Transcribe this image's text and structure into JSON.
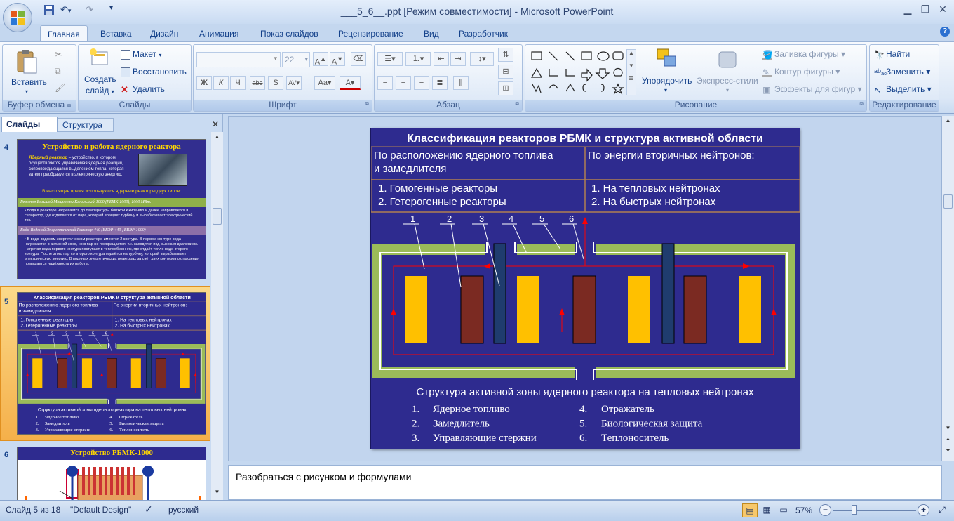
{
  "window": {
    "title": "___5_6__.ppt [Режим совместимости] - Microsoft PowerPoint"
  },
  "tabs": [
    {
      "label": "Главная",
      "active": true
    },
    {
      "label": "Вставка"
    },
    {
      "label": "Дизайн"
    },
    {
      "label": "Анимация"
    },
    {
      "label": "Показ слайдов"
    },
    {
      "label": "Рецензирование"
    },
    {
      "label": "Вид"
    },
    {
      "label": "Разработчик"
    }
  ],
  "ribbon": {
    "clipboard": {
      "label": "Буфер обмена",
      "paste": "Вставить"
    },
    "slides": {
      "label": "Слайды",
      "new_slide_1": "Создать",
      "new_slide_2": "слайд",
      "layout": "Макет",
      "reset": "Восстановить",
      "delete": "Удалить"
    },
    "font": {
      "label": "Шрифт",
      "size": "22"
    },
    "paragraph": {
      "label": "Абзац"
    },
    "drawing": {
      "label": "Рисование",
      "arrange": "Упорядочить",
      "quick_styles": "Экспресс-стили",
      "fill": "Заливка фигуры",
      "outline": "Контур фигуры",
      "effects": "Эффекты для фигур"
    },
    "editing": {
      "label": "Редактирование",
      "find": "Найти",
      "replace": "Заменить",
      "select": "Выделить"
    }
  },
  "left_panel": {
    "tab_slides": "Слайды",
    "tab_outline": "Структура",
    "slides": [
      {
        "number": "4",
        "title": "Устройство и работа ядерного реактора",
        "text_lead": "Ядерный реактор",
        "text_body": " – устройство, в котором осуществляется управляемая ядерная реакция, сопровождающаяся выделением тепла, которая затем преобразуется в электрическую энергию.",
        "types_line": "В настоящее время используются ядерные реакторы двух типов:",
        "rbmk_title": "Реактор Большой Мощности Канальный-1000 (РБМК-1000), 1000 МВт.",
        "rbmk_text": "Вода в реакторе нагревается до температуры близкой к кипению и далее направляется в сепаратор, где отделяется от пара, который вращает турбину и вырабатывает электрический ток.",
        "vver_title": "Водо-Водяной Энергетический Реактор-440 (ВВЭР-440 , ВВЭР-1000)",
        "vver_text": "В водо-водяном энергетическом реакторе имеются 2 контура. В первом контуре вода нагревается в активной зоне, но в пар не превращается, т.к. находится под высоким давлением. Нагретая вода первого контура поступает в теплообменник, где отдаёт тепло воде второго контура. После этого пар со второго контура подаётся на турбину, который вырабатывает электрическую энергию. В водяных энергетических реакторах за счёт двух контуров охлаждения повышается надёжность их работы."
      },
      {
        "number": "5"
      },
      {
        "number": "6",
        "title": "Устройство РБМК-1000"
      }
    ]
  },
  "slide": {
    "title": "Классификация реакторов РБМК и структура активной области",
    "col1_header": "По расположению ядерного топлива и замедлителя",
    "col2_header": "По энергии вторичных нейтронов:",
    "col1_items": [
      "Гомогенные реакторы",
      "Гетерогенные реакторы"
    ],
    "col2_items": [
      "На тепловых нейтронах",
      "На быстрых нейтронах"
    ],
    "diagram_labels": [
      "1",
      "2",
      "3",
      "4",
      "5",
      "6"
    ],
    "caption": "Структура активной зоны ядерного реактора на тепловых нейтронах",
    "legend_nums": [
      "1.",
      "2.",
      "3.",
      "4.",
      "5.",
      "6."
    ],
    "legend": [
      "Ядерное топливо",
      "Замедлитель",
      "Управляющие стержни",
      "Отражатель",
      "Биологическая защита",
      "Теплоноситель"
    ],
    "thumb_title": "Классификация  реакторов  РБМК и структура  активной  области"
  },
  "notes": {
    "text": "Разобраться с рисунком и формулами"
  },
  "status": {
    "slide_of": "Слайд 5 из 18",
    "theme": "\"Default Design\"",
    "language": "русский",
    "zoom": "57%"
  },
  "colors": {
    "slide_bg": "#2e2b8f",
    "fuel": "#ffc000",
    "moderator": "#7b2a22",
    "rod": "#1f3c6e",
    "reflector": "#9bbb59",
    "coolant": "#ff0000"
  }
}
